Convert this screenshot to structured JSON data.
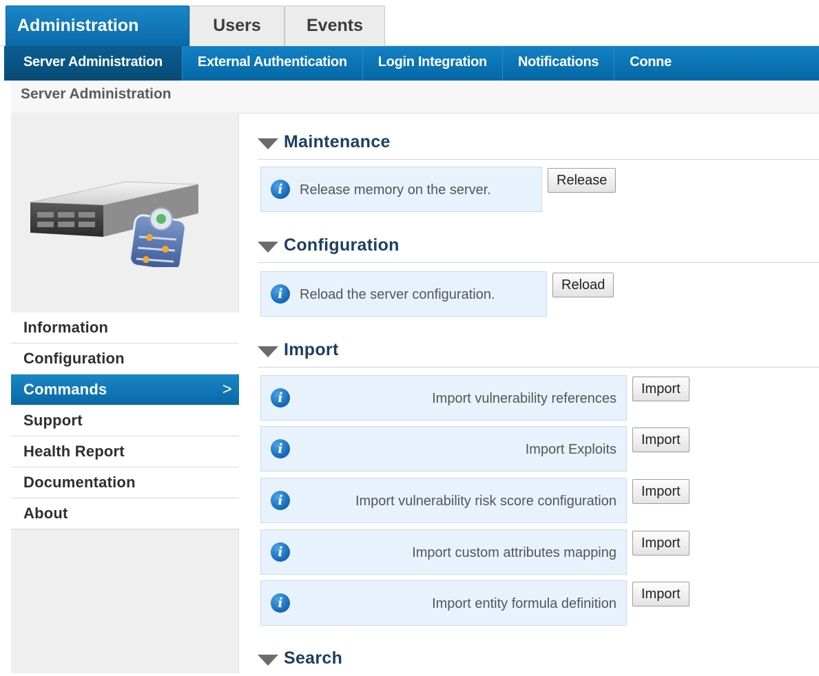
{
  "top_tabs": [
    {
      "label": "Administration",
      "active": true
    },
    {
      "label": "Users",
      "active": false
    },
    {
      "label": "Events",
      "active": false
    }
  ],
  "sub_nav": [
    {
      "label": "Server Administration",
      "active": true
    },
    {
      "label": "External Authentication",
      "active": false
    },
    {
      "label": "Login Integration",
      "active": false
    },
    {
      "label": "Notifications",
      "active": false
    },
    {
      "label": "Conne",
      "active": false
    }
  ],
  "breadcrumb": "Server Administration",
  "sidebar": {
    "image_icon": "server-settings-icon",
    "items": [
      {
        "label": "Information",
        "active": false
      },
      {
        "label": "Configuration",
        "active": false
      },
      {
        "label": "Commands",
        "active": true
      },
      {
        "label": "Support",
        "active": false
      },
      {
        "label": "Health Report",
        "active": false
      },
      {
        "label": "Documentation",
        "active": false
      },
      {
        "label": "About",
        "active": false
      }
    ],
    "active_chevron": ">"
  },
  "sections": {
    "maintenance": {
      "title": "Maintenance",
      "commands": [
        {
          "text": "Release memory on the server.",
          "button": "Release"
        }
      ]
    },
    "configuration": {
      "title": "Configuration",
      "commands": [
        {
          "text": "Reload the server configuration.",
          "button": "Reload"
        }
      ]
    },
    "import": {
      "title": "Import",
      "commands": [
        {
          "text": "Import vulnerability references",
          "button": "Import"
        },
        {
          "text": "Import Exploits",
          "button": "Import"
        },
        {
          "text": "Import vulnerability risk score configuration",
          "button": "Import"
        },
        {
          "text": "Import custom attributes mapping",
          "button": "Import"
        },
        {
          "text": "Import entity formula definition",
          "button": "Import"
        }
      ]
    },
    "search": {
      "title": "Search"
    }
  },
  "info_icon_glyph": "i",
  "colors": {
    "accent": "#0a6aa6",
    "section_title": "#1d3f62",
    "info_bg": "#e7f2fc"
  }
}
